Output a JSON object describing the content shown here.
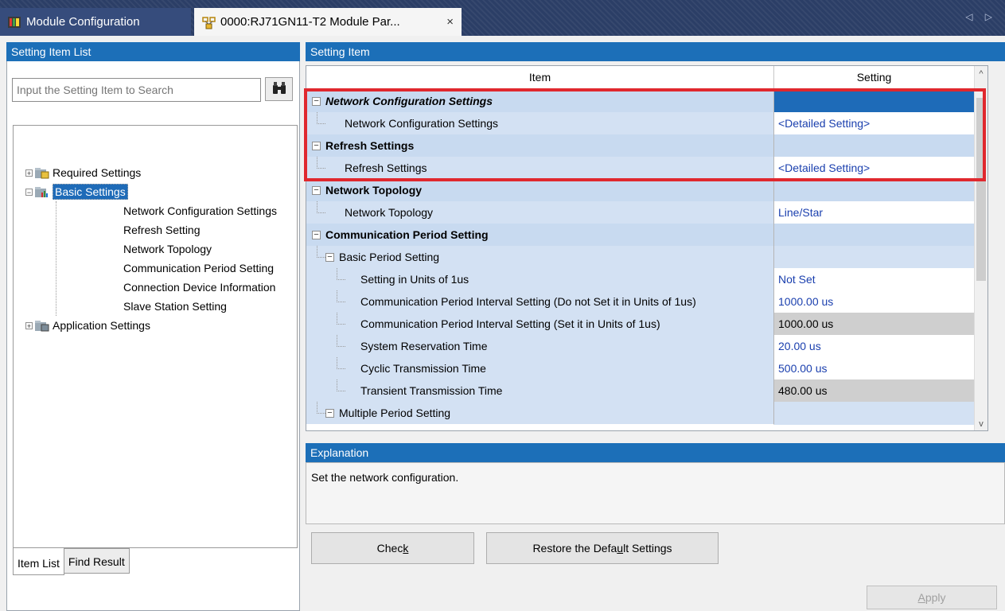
{
  "tabs": [
    {
      "label": "Module Configuration",
      "active": false
    },
    {
      "label": "0000:RJ71GN11-T2 Module Par...",
      "active": true,
      "close": "×"
    }
  ],
  "tab_scroll": "◁ ▷",
  "left": {
    "header": "Setting Item List",
    "search_placeholder": "Input the Setting Item to Search",
    "tree": {
      "required": "Required Settings",
      "basic": "Basic Settings",
      "basic_children": [
        "Network Configuration Settings",
        "Refresh Setting",
        "Network Topology",
        "Communication Period Setting",
        "Connection Device Information",
        "Slave Station Setting"
      ],
      "application": "Application Settings"
    },
    "bottom_tabs": [
      "Item List",
      "Find Result"
    ]
  },
  "grid": {
    "header": "Setting Item",
    "col_item": "Item",
    "col_setting": "Setting",
    "rows": [
      {
        "item": "Network Configuration Settings",
        "setting": ""
      },
      {
        "item": "Network Configuration Settings",
        "setting": "<Detailed Setting>"
      },
      {
        "item": "Refresh Settings",
        "setting": ""
      },
      {
        "item": "Refresh Settings",
        "setting": "<Detailed Setting>"
      },
      {
        "item": "Network Topology",
        "setting": ""
      },
      {
        "item": "Network Topology",
        "setting": "Line/Star"
      },
      {
        "item": "Communication Period Setting",
        "setting": ""
      },
      {
        "item": "Basic Period Setting",
        "setting": ""
      },
      {
        "item": "Setting in Units of 1us",
        "setting": "Not Set"
      },
      {
        "item": "Communication Period Interval Setting (Do not Set it in Units of 1us)",
        "setting": "1000.00 us"
      },
      {
        "item": "Communication Period Interval Setting (Set it in Units of 1us)",
        "setting": "1000.00 us"
      },
      {
        "item": "System Reservation Time",
        "setting": "20.00 us"
      },
      {
        "item": "Cyclic Transmission Time",
        "setting": "500.00 us"
      },
      {
        "item": "Transient Transmission Time",
        "setting": "480.00 us"
      },
      {
        "item": "Multiple Period Setting",
        "setting": ""
      }
    ]
  },
  "explanation": {
    "header": "Explanation",
    "text": "Set the network configuration."
  },
  "buttons": {
    "check_pre": "Chec",
    "check_key": "k",
    "restore_pre": "Restore the Defa",
    "restore_key": "u",
    "restore_post": "lt Settings",
    "apply_key": "A",
    "apply_post": "pply"
  },
  "colors": {
    "header_blue": "#1c6fb8",
    "category_bg": "#c8daf0",
    "highlight_red": "#e0282e",
    "setting_text": "#1a3fae"
  }
}
